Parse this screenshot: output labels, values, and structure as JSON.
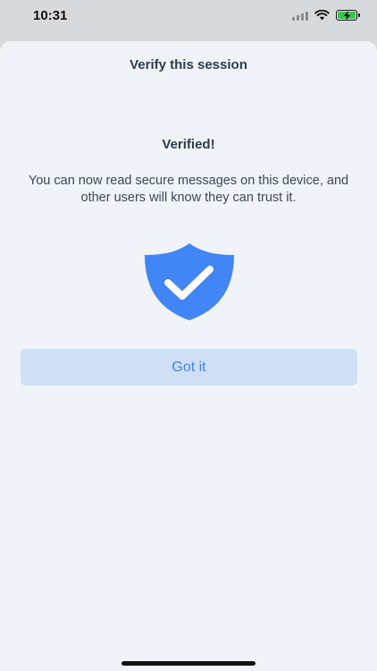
{
  "status_bar": {
    "time": "10:31"
  },
  "sheet": {
    "title": "Verify this session",
    "heading": "Verified!",
    "description": "You can now read secure messages on this device, and other users will know they can trust it.",
    "button_label": "Got it"
  },
  "icons": {
    "shield": "shield-check-icon"
  },
  "colors": {
    "accent": "#4285f4",
    "button_bg": "#cfdff5",
    "button_text": "#3f82e0",
    "sheet_bg": "#f0f3f7"
  }
}
